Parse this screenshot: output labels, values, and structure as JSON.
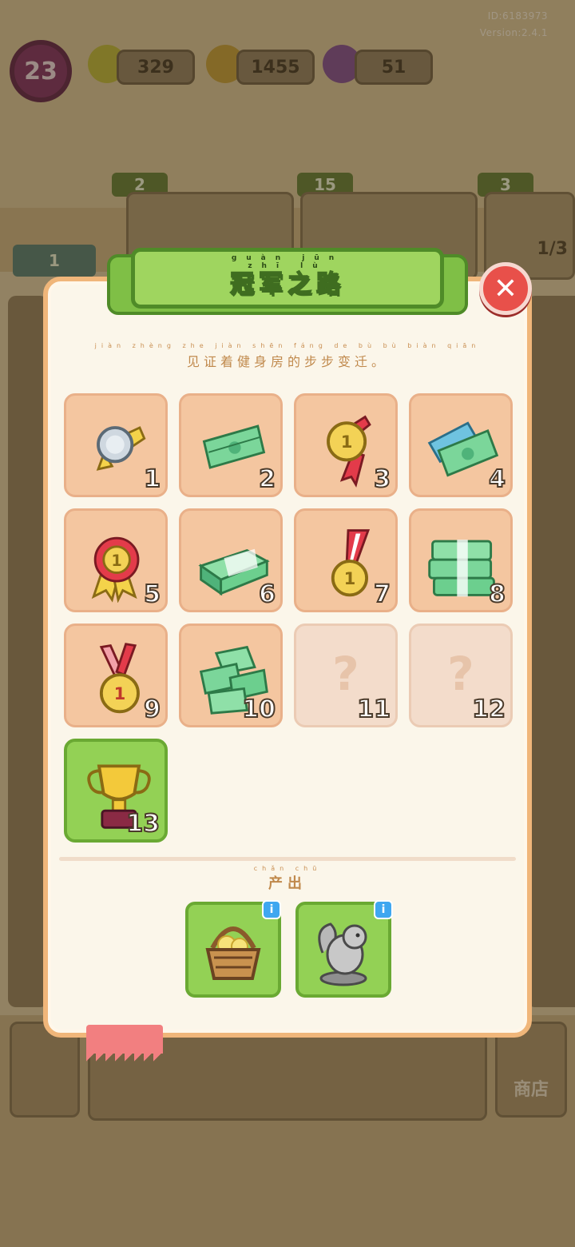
{
  "hud": {
    "id_text": "ID:6183973",
    "version_text": "Version:2.4.1",
    "level": "23",
    "energy": "329",
    "coins": "1455",
    "gems": "51",
    "colors": {
      "energy": "#c5c23a",
      "coins": "#c9a43a",
      "gems": "#8a4fa8"
    }
  },
  "background": {
    "card_tags": [
      "2",
      "15",
      "3"
    ],
    "left_count": "1",
    "right_card_progress": "1/3",
    "shop_label": "商店"
  },
  "modal": {
    "title": "冠军之路",
    "title_pinyin": "guàn jūn zhī lù",
    "subtitle": "见证着健身房的步步变迁。",
    "subtitle_pinyin": "jiàn zhèng zhe jiàn shēn fáng de bù bù biàn qiān",
    "close_icon": "close-icon",
    "output_label": "产出",
    "output_pinyin": "chǎn chū",
    "accent_green": "#93d155",
    "accent_red": "#e8504a"
  },
  "collection": [
    {
      "num": "1",
      "icon": "silver-medal-ribbon-icon",
      "state": "unlocked"
    },
    {
      "num": "2",
      "icon": "cash-bills-icon",
      "state": "unlocked"
    },
    {
      "num": "3",
      "icon": "gold-medal-red-ribbon-icon",
      "state": "unlocked"
    },
    {
      "num": "4",
      "icon": "cash-fan-icon",
      "state": "unlocked"
    },
    {
      "num": "5",
      "icon": "gold-rosette-icon",
      "state": "unlocked"
    },
    {
      "num": "6",
      "icon": "cash-stack-icon",
      "state": "unlocked"
    },
    {
      "num": "7",
      "icon": "gold-medal-lanyard-icon",
      "state": "unlocked"
    },
    {
      "num": "8",
      "icon": "cash-bundles-icon",
      "state": "unlocked"
    },
    {
      "num": "9",
      "icon": "gold-medal-pink-ribbon-icon",
      "state": "unlocked"
    },
    {
      "num": "10",
      "icon": "cash-pile-icon",
      "state": "unlocked"
    },
    {
      "num": "11",
      "icon": "unknown-icon",
      "state": "locked",
      "placeholder": "?"
    },
    {
      "num": "12",
      "icon": "unknown-icon",
      "state": "locked",
      "placeholder": "?"
    },
    {
      "num": "13",
      "icon": "gold-trophy-icon",
      "state": "current"
    }
  ],
  "outputs": [
    {
      "icon": "flower-basket-icon",
      "info": "i"
    },
    {
      "icon": "squirrel-statue-icon",
      "info": "i"
    }
  ],
  "close_symbol": "✕"
}
